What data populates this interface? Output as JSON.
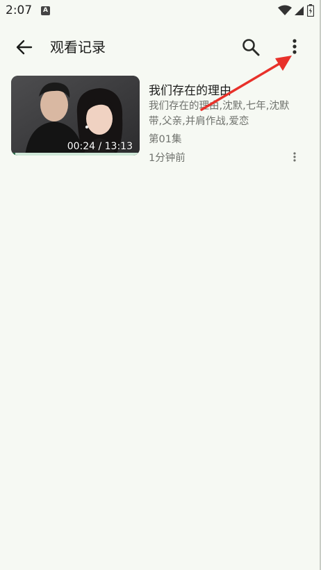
{
  "status_bar": {
    "time": "2:07",
    "notification_badge": "A"
  },
  "app_bar": {
    "title": "观看记录",
    "back_icon": "arrow-back-icon",
    "search_icon": "search-icon",
    "more_icon": "more-vert-icon"
  },
  "history": [
    {
      "title": "我们存在的理由",
      "tags": "我们存在的理由,沈默,七年,沈默带,父亲,并肩作战,爱恋",
      "episode": "第01集",
      "watched": "1分钟前",
      "duration": "00:24 / 13:13",
      "progress": 0.03
    }
  ],
  "colors": {
    "background": "#f6f9f3",
    "progress": "#2f6e4e",
    "annotation_arrow": "#e8312a"
  }
}
